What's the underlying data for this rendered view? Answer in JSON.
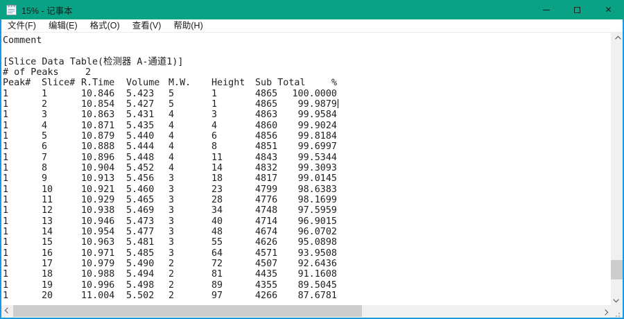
{
  "window": {
    "title": "15% - 记事本",
    "accent_titlebar": "#09a285",
    "accent_border": "#1699e0",
    "controls": {
      "minimize_label": "minimize",
      "maximize_label": "maximize",
      "close_glyph": "✕"
    }
  },
  "menu": {
    "items": [
      "文件(F)",
      "编辑(E)",
      "格式(O)",
      "查看(V)",
      "帮助(H)"
    ]
  },
  "document": {
    "comment_line": "Comment",
    "section_header": "[Slice Data Table(检测器 A-通道1)]",
    "peaks_label": "# of Peaks",
    "peaks_value": "2",
    "caret_after_row": 2,
    "table": {
      "headers": [
        "Peak#",
        "Slice#",
        "R.Time",
        "Volume",
        "M.W.",
        "Height",
        "Sub Total",
        "%"
      ],
      "rows": [
        [
          "1",
          "1",
          "10.846",
          "5.423",
          "5",
          "1",
          "4865",
          "100.0000"
        ],
        [
          "1",
          "2",
          "10.854",
          "5.427",
          "5",
          "1",
          "4865",
          "99.9879"
        ],
        [
          "1",
          "3",
          "10.863",
          "5.431",
          "4",
          "3",
          "4863",
          "99.9584"
        ],
        [
          "1",
          "4",
          "10.871",
          "5.435",
          "4",
          "4",
          "4860",
          "99.9024"
        ],
        [
          "1",
          "5",
          "10.879",
          "5.440",
          "4",
          "6",
          "4856",
          "99.8184"
        ],
        [
          "1",
          "6",
          "10.888",
          "5.444",
          "4",
          "8",
          "4851",
          "99.6997"
        ],
        [
          "1",
          "7",
          "10.896",
          "5.448",
          "4",
          "11",
          "4843",
          "99.5344"
        ],
        [
          "1",
          "8",
          "10.904",
          "5.452",
          "4",
          "14",
          "4832",
          "99.3093"
        ],
        [
          "1",
          "9",
          "10.913",
          "5.456",
          "3",
          "18",
          "4817",
          "99.0145"
        ],
        [
          "1",
          "10",
          "10.921",
          "5.460",
          "3",
          "23",
          "4799",
          "98.6383"
        ],
        [
          "1",
          "11",
          "10.929",
          "5.465",
          "3",
          "28",
          "4776",
          "98.1699"
        ],
        [
          "1",
          "12",
          "10.938",
          "5.469",
          "3",
          "34",
          "4748",
          "97.5959"
        ],
        [
          "1",
          "13",
          "10.946",
          "5.473",
          "3",
          "40",
          "4714",
          "96.9015"
        ],
        [
          "1",
          "14",
          "10.954",
          "5.477",
          "3",
          "48",
          "4674",
          "96.0702"
        ],
        [
          "1",
          "15",
          "10.963",
          "5.481",
          "3",
          "55",
          "4626",
          "95.0898"
        ],
        [
          "1",
          "16",
          "10.971",
          "5.485",
          "3",
          "64",
          "4571",
          "93.9508"
        ],
        [
          "1",
          "17",
          "10.979",
          "5.490",
          "2",
          "72",
          "4507",
          "92.6436"
        ],
        [
          "1",
          "18",
          "10.988",
          "5.494",
          "2",
          "81",
          "4435",
          "91.1608"
        ],
        [
          "1",
          "19",
          "10.996",
          "5.498",
          "2",
          "89",
          "4355",
          "89.5045"
        ],
        [
          "1",
          "20",
          "11.004",
          "5.502",
          "2",
          "97",
          "4266",
          "87.6781"
        ]
      ]
    }
  },
  "scrollbars": {
    "vertical": {
      "up_icon": "chevron-up",
      "down_icon": "chevron-down"
    },
    "horizontal": {
      "left_icon": "chevron-left",
      "right_icon": "chevron-right"
    },
    "resize_grip_icon": "dot-triangle"
  }
}
